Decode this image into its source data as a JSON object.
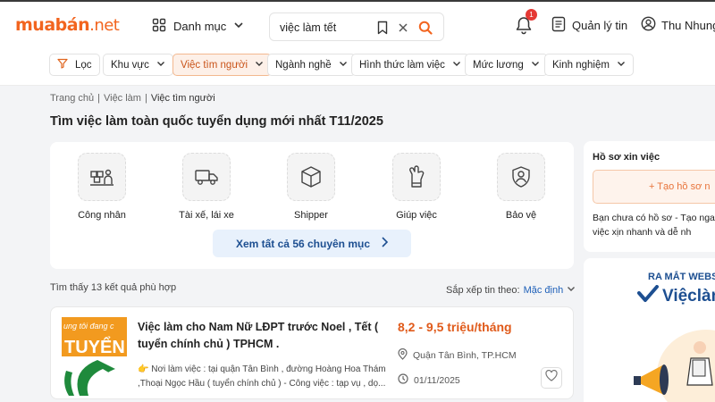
{
  "header": {
    "logo_part1": "muabán",
    "logo_part2": ".net",
    "category_label": "Danh mục",
    "search_value": "việc làm tết",
    "notification_count": "1",
    "manage_label": "Quản lý tin",
    "user_name": "Thu Nhung"
  },
  "filters": [
    {
      "label": "Lọc"
    },
    {
      "label": "Khu vực"
    },
    {
      "label": "Việc tìm người"
    },
    {
      "label": "Ngành nghề"
    },
    {
      "label": "Hình thức làm việc"
    },
    {
      "label": "Mức lương"
    },
    {
      "label": "Kinh nghiệm"
    }
  ],
  "breadcrumb": [
    "Trang chủ",
    "Việc làm",
    "Việc tìm người"
  ],
  "page_title": "Tìm việc làm toàn quốc tuyển dụng mới nhất T11/2025",
  "categories": [
    {
      "label": "Công nhân",
      "icon": "worker-icon"
    },
    {
      "label": "Tài xế, lái xe",
      "icon": "truck-icon"
    },
    {
      "label": "Shipper",
      "icon": "box-icon"
    },
    {
      "label": "Giúp việc",
      "icon": "glove-icon"
    },
    {
      "label": "Bảo vệ",
      "icon": "guard-icon"
    }
  ],
  "view_all_label": "Xem tất cả 56 chuyên mục",
  "results": {
    "found_text": "Tìm thấy 13 kết quả phù hợp",
    "sort_label": "Sắp xếp tin theo:",
    "sort_value": "Mặc định"
  },
  "job": {
    "title": "Việc làm cho Nam Nữ LĐPT trước Noel , Tết ( tuyển chính chủ ) TPHCM .",
    "description": "Nơi làm việc : tại quận Tân Bình , đường Hoàng Hoa Thám ,Thoại Ngọc Hầu ( tuyển chính chủ ) - Công việc : tạp vụ , dọ...",
    "salary": "8,2 - 9,5 triệu/tháng",
    "location": "Quận Tân Bình, TP.HCM",
    "date": "01/11/2025",
    "image_text_top": "ung tôi đang c",
    "image_text_main": "TUYỂN"
  },
  "profile": {
    "heading": "Hồ sơ xin việc",
    "create_label": "+ Tạo hồ sơ n",
    "text": "Bạn chưa có hồ sơ - Tạo nga \"săn\" việc xịn nhanh và dễ nh"
  },
  "promo": {
    "line1": "RA MẮT WEBSI",
    "brand": "Việclàm"
  },
  "colors": {
    "brand_orange": "#f2641e",
    "accent_blue": "#1d4f91",
    "salary": "#e05a1a"
  }
}
